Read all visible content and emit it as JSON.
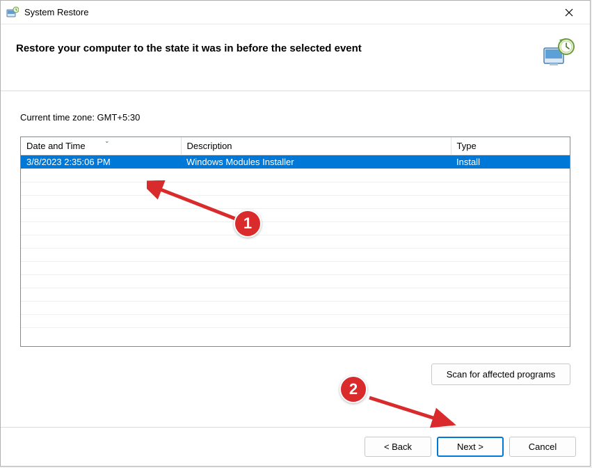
{
  "window": {
    "title": "System Restore"
  },
  "header": {
    "title": "Restore your computer to the state it was in before the selected event"
  },
  "timezone_label": "Current time zone: GMT+5:30",
  "table": {
    "columns": {
      "date": "Date and Time",
      "description": "Description",
      "type": "Type"
    },
    "rows": [
      {
        "date": "3/8/2023 2:35:06 PM",
        "description": "Windows Modules Installer",
        "type": "Install"
      }
    ]
  },
  "buttons": {
    "scan": "Scan for affected programs",
    "back": "< Back",
    "next": "Next >",
    "cancel": "Cancel"
  },
  "annotations": {
    "badge1": "1",
    "badge2": "2"
  }
}
